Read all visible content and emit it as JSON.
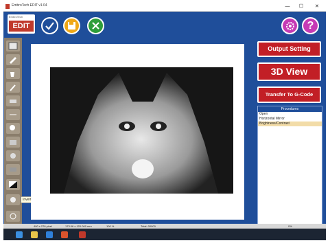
{
  "window": {
    "title": "EmbroTech EDIT v1.04",
    "controls": {
      "minimize": "—",
      "maximize": "☐",
      "close": "✕"
    }
  },
  "toolbar": {
    "logo_brand": "EmbroTech",
    "logo_text": "EDIT",
    "check_icon": "check-icon",
    "save_icon": "save-icon",
    "close_icon": "close-icon",
    "settings_icon": "gear-icon",
    "help_label": "?"
  },
  "right_panel": {
    "output_setting_label": "Output Setting",
    "view3d_label": "3D View",
    "transfer_label": "Transfer To G-Code"
  },
  "layers": {
    "header": "Procedures",
    "items": [
      {
        "label": "Open",
        "selected": false
      },
      {
        "label": "Horizontal Mirror",
        "selected": false
      },
      {
        "label": "Brightness/Contrast",
        "selected": true
      }
    ]
  },
  "left_tools": {
    "tooltip": "Invert"
  },
  "status": {
    "size_px": "400 x 276 pixel",
    "size_mm": "173.06 x 120.000 mm",
    "zoom": "100 %",
    "extra": "Total: 00000",
    "percent": "0%"
  },
  "colors": {
    "frame_blue": "#1f4e9a",
    "button_red": "#c21f26",
    "selected_row": "#f2dca8"
  }
}
